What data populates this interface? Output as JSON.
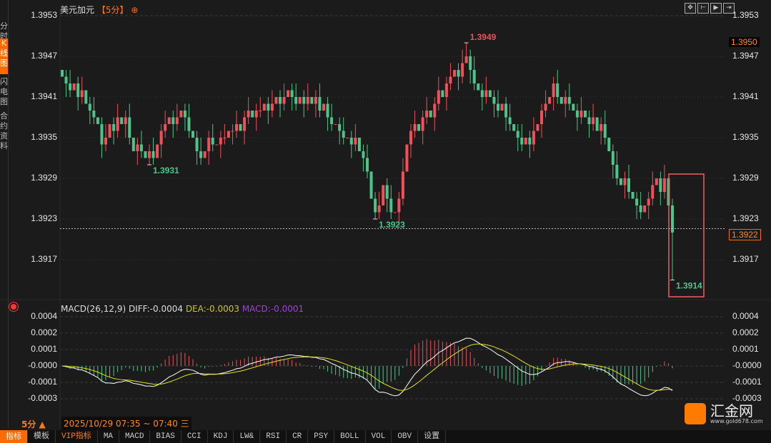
{
  "left_tabs": [
    {
      "label": "分时图"
    },
    {
      "label": "K线图",
      "active": true
    },
    {
      "label": "闪电图"
    },
    {
      "label": "合约资料"
    }
  ],
  "header": {
    "symbol": "美元加元",
    "period": "【5分】",
    "add_icon": "circle-plus-icon"
  },
  "toolbar_icons": [
    "crosshair-icon",
    "fit-range-icon",
    "zoom-in-icon",
    "scroll-end-icon"
  ],
  "price_axis": {
    "ticks": [
      "1.3953",
      "1.3947",
      "1.3941",
      "1.3935",
      "1.3929",
      "1.3923",
      "1.3917"
    ],
    "high_label": "1.3950",
    "current_label": "1.3922"
  },
  "annotations": [
    {
      "label": "1.3931",
      "value": 1.3931,
      "index": 22,
      "color": "#4fc48a"
    },
    {
      "label": "1.3923",
      "value": 1.3923,
      "index": 79,
      "color": "#4fc48a"
    },
    {
      "label": "1.3949",
      "value": 1.3949,
      "index": 102,
      "color": "#f0505a"
    },
    {
      "label": "1.3914",
      "value": 1.3914,
      "index": 154,
      "color": "#4fc48a"
    }
  ],
  "macd": {
    "title": "MACD(26,12,9)",
    "diff": "DIFF:-0.0004",
    "dea": "DEA:-0.0003",
    "macd": "MACD:-0.0001",
    "ticks": [
      "0.0004",
      "0.0002",
      "0.0001",
      "-0.0000",
      "-0.0001",
      "-0.0003"
    ],
    "colors": {
      "diff": "#ffffff",
      "dea": "#e0e020",
      "macd": "#b040e0"
    }
  },
  "period_control": "5分 ▲",
  "date_range": "2025/10/29 07:35 ~ 07:40 三",
  "bottom_tabs": [
    "指标",
    "模板",
    "VIP指标",
    "MA",
    "MACD",
    "BIAS",
    "CCI",
    "KDJ",
    "LW&",
    "RSI",
    "CR",
    "PSY",
    "BOLL",
    "VOL",
    "OBV",
    "设置"
  ],
  "logo": {
    "name": "汇金网",
    "url": "www.gold678.com"
  },
  "colors": {
    "up": "#f0505a",
    "down": "#4fc48a",
    "accent": "#ff6a00",
    "highlight_box": "#f06060"
  },
  "chart_data": {
    "type": "candlestick",
    "ylim": [
      1.3911,
      1.3955
    ],
    "current_price": 1.3922,
    "closes": [
      1.3944,
      1.3943,
      1.3942,
      1.3943,
      1.3941,
      1.3942,
      1.394,
      1.3939,
      1.3938,
      1.3937,
      1.3934,
      1.3935,
      1.3937,
      1.3936,
      1.3938,
      1.3937,
      1.3938,
      1.3935,
      1.3933,
      1.3934,
      1.3933,
      1.3932,
      1.3933,
      1.3932,
      1.3934,
      1.3936,
      1.3937,
      1.3938,
      1.3937,
      1.3938,
      1.3939,
      1.3938,
      1.3936,
      1.3935,
      1.3933,
      1.3932,
      1.3933,
      1.3935,
      1.3934,
      1.3934,
      1.3935,
      1.3935,
      1.3936,
      1.3936,
      1.3937,
      1.3936,
      1.3938,
      1.3939,
      1.3938,
      1.3939,
      1.3939,
      1.394,
      1.3939,
      1.394,
      1.3941,
      1.394,
      1.3941,
      1.3942,
      1.3941,
      1.394,
      1.3941,
      1.394,
      1.3941,
      1.394,
      1.3941,
      1.3939,
      1.394,
      1.3938,
      1.3937,
      1.3937,
      1.3936,
      1.3935,
      1.3935,
      1.3934,
      1.3935,
      1.3933,
      1.3932,
      1.393,
      1.3926,
      1.3924,
      1.3925,
      1.3928,
      1.3926,
      1.3924,
      1.3924,
      1.3926,
      1.393,
      1.3934,
      1.3936,
      1.3937,
      1.3936,
      1.3938,
      1.3939,
      1.3938,
      1.394,
      1.3942,
      1.3941,
      1.3943,
      1.3944,
      1.3945,
      1.3944,
      1.3946,
      1.3947,
      1.3945,
      1.3943,
      1.3942,
      1.3941,
      1.3942,
      1.3941,
      1.394,
      1.3939,
      1.394,
      1.3938,
      1.3937,
      1.3936,
      1.3935,
      1.3934,
      1.3935,
      1.3934,
      1.3936,
      1.3937,
      1.3939,
      1.394,
      1.3941,
      1.3943,
      1.3941,
      1.394,
      1.3941,
      1.394,
      1.3939,
      1.3938,
      1.3939,
      1.3938,
      1.3937,
      1.3938,
      1.3936,
      1.3937,
      1.3935,
      1.3933,
      1.3931,
      1.3929,
      1.3928,
      1.3929,
      1.3927,
      1.3926,
      1.3925,
      1.3924,
      1.3925,
      1.3926,
      1.3928,
      1.3929,
      1.3927,
      1.3929,
      1.3925,
      1.3921
    ]
  }
}
